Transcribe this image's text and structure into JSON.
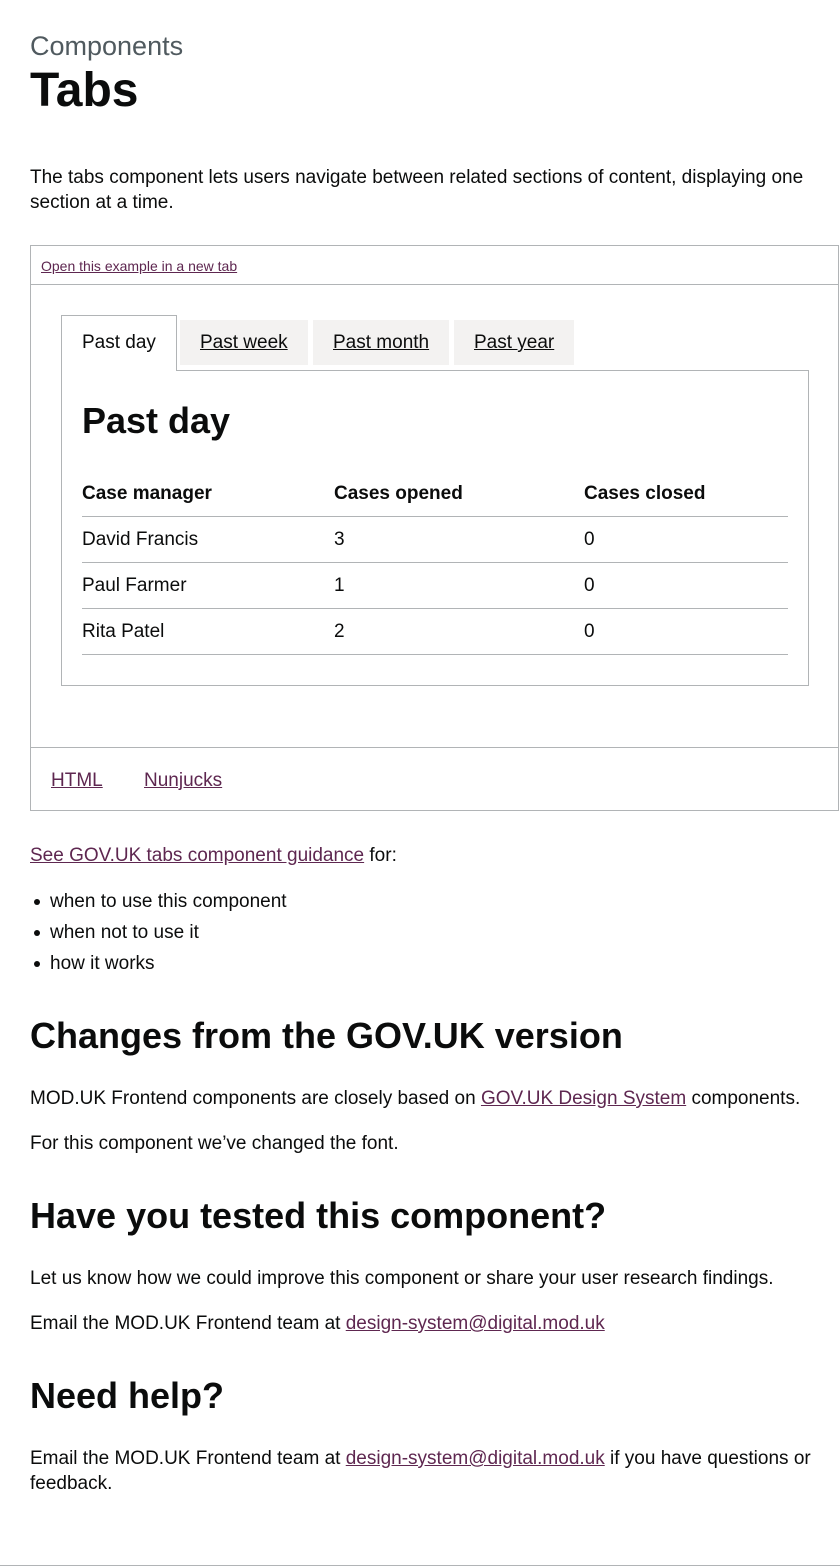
{
  "header": {
    "caption": "Components",
    "title": "Tabs"
  },
  "lead": "The tabs component lets users navigate between related sections of content, displaying one section at a time.",
  "example": {
    "open_link": "Open this example in a new tab",
    "tabs": [
      {
        "label": "Past day",
        "selected": true
      },
      {
        "label": "Past week",
        "selected": false
      },
      {
        "label": "Past month",
        "selected": false
      },
      {
        "label": "Past year",
        "selected": false
      }
    ],
    "panel": {
      "heading": "Past day",
      "columns": [
        "Case manager",
        "Cases opened",
        "Cases closed"
      ],
      "rows": [
        [
          "David Francis",
          "3",
          "0"
        ],
        [
          "Paul Farmer",
          "1",
          "0"
        ],
        [
          "Rita Patel",
          "2",
          "0"
        ]
      ]
    },
    "code_tabs": [
      "HTML",
      "Nunjucks"
    ]
  },
  "guidance": {
    "link": "See GOV.UK tabs component guidance",
    "suffix": " for:",
    "bullets": [
      "when to use this component",
      "when not to use it",
      "how it works"
    ]
  },
  "changes": {
    "heading": "Changes from the GOV.UK version",
    "p1_before": "MOD.UK Frontend components are closely based on ",
    "p1_link": "GOV.UK Design System",
    "p1_after": " components.",
    "p2": "For this component we’ve changed the font."
  },
  "tested": {
    "heading": "Have you tested this component?",
    "p1": "Let us know how we could improve this component or share your user research findings.",
    "p2_before": "Email the MOD.UK Frontend team at ",
    "p2_link": "design-system@digital.mod.uk"
  },
  "help": {
    "heading": "Need help?",
    "p_before": "Email the MOD.UK Frontend team at ",
    "p_link": "design-system@digital.mod.uk",
    "p_after": " if you have questions or feedback."
  },
  "colors": {
    "link": "#5e2750",
    "text": "#0b0c0c",
    "border": "#b1b4b6",
    "tab_bg": "#f3f2f1",
    "caption": "#505a5f"
  }
}
